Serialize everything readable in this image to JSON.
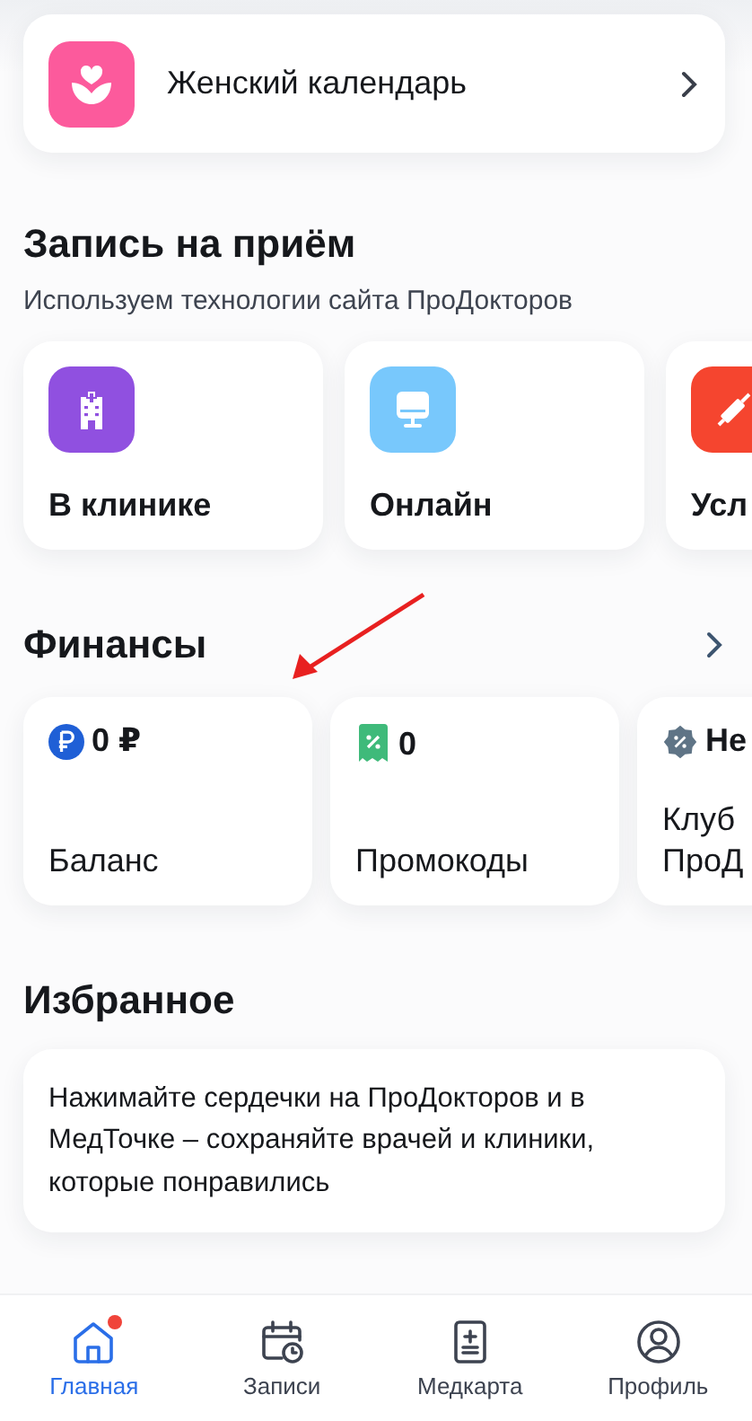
{
  "calendar_card": {
    "title": "Женский календарь"
  },
  "appointment": {
    "title": "Запись на приём",
    "subtitle": "Используем технологии сайта ПроДокторов",
    "options": [
      {
        "kind": "clinic",
        "label": "В клинике"
      },
      {
        "kind": "online",
        "label": "Онлайн"
      },
      {
        "kind": "services",
        "label": "Усл"
      }
    ]
  },
  "finances": {
    "title": "Финансы",
    "cards": [
      {
        "kind": "balance",
        "value": "0 ₽",
        "label": "Баланс"
      },
      {
        "kind": "promo",
        "value": "0",
        "label": "Промокоды"
      },
      {
        "kind": "club",
        "value": "Не",
        "label": "Клуб\nПроД"
      }
    ]
  },
  "favorites": {
    "title": "Избранное",
    "text": "Нажимайте сердечки на ПроДокторов и в МедТочке – сохраняйте врачей и клиники, которые понравились"
  },
  "tab_bar": [
    {
      "kind": "home",
      "label": "Главная",
      "selected": true,
      "badge": true
    },
    {
      "kind": "records",
      "label": "Записи",
      "selected": false,
      "badge": false
    },
    {
      "kind": "medcard",
      "label": "Медкарта",
      "selected": false,
      "badge": false
    },
    {
      "kind": "profile",
      "label": "Профиль",
      "selected": false,
      "badge": false
    }
  ]
}
